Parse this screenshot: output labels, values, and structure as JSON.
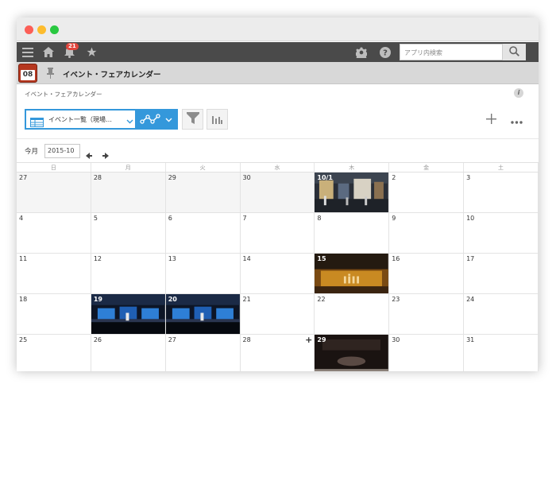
{
  "header": {
    "notification_count": "21",
    "search_placeholder": "アプリ内検索"
  },
  "app": {
    "icon_day": "08",
    "title": "イベント・フェアカレンダー",
    "breadcrumb": "イベント・フェアカレンダー"
  },
  "toolbar": {
    "view_label": "イベント一覧（現場…"
  },
  "calendar": {
    "today_label": "今月",
    "month_value": "2015-10",
    "weekdays": [
      "日",
      "月",
      "火",
      "水",
      "木",
      "金",
      "土"
    ],
    "days": [
      {
        "label": "27",
        "muted": true
      },
      {
        "label": "28",
        "muted": true
      },
      {
        "label": "29",
        "muted": true
      },
      {
        "label": "30",
        "muted": true
      },
      {
        "label": "10/1",
        "photo": "expo"
      },
      {
        "label": "2"
      },
      {
        "label": "3"
      },
      {
        "label": "4"
      },
      {
        "label": "5"
      },
      {
        "label": "6"
      },
      {
        "label": "7"
      },
      {
        "label": "8"
      },
      {
        "label": "9"
      },
      {
        "label": "10"
      },
      {
        "label": "11"
      },
      {
        "label": "12"
      },
      {
        "label": "13"
      },
      {
        "label": "14"
      },
      {
        "label": "15",
        "photo": "sign"
      },
      {
        "label": "16"
      },
      {
        "label": "17"
      },
      {
        "label": "18"
      },
      {
        "label": "19",
        "photo": "stage"
      },
      {
        "label": "20",
        "photo": "stage"
      },
      {
        "label": "21"
      },
      {
        "label": "22"
      },
      {
        "label": "23"
      },
      {
        "label": "24"
      },
      {
        "label": "25"
      },
      {
        "label": "26"
      },
      {
        "label": "27"
      },
      {
        "label": "28",
        "add": "+"
      },
      {
        "label": "29",
        "photo": "dark"
      },
      {
        "label": "30"
      },
      {
        "label": "31"
      }
    ]
  },
  "colors": {
    "accent": "#3498db",
    "topbar": "#4a4a4a",
    "appbar": "#d8d8d8",
    "badge": "#e2453c"
  }
}
